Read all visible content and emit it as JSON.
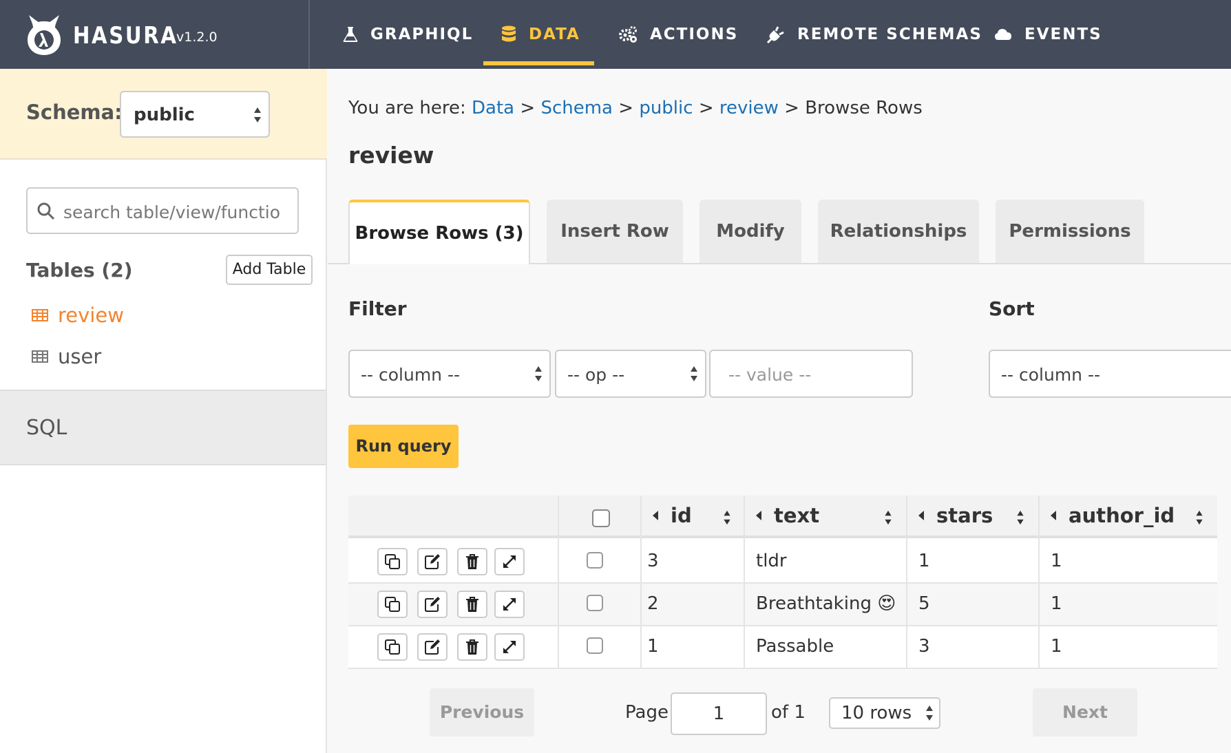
{
  "app": {
    "brand": "HASURA",
    "version": "v1.2.0"
  },
  "nav": {
    "items": [
      {
        "label": "GRAPHIQL",
        "icon": "flask-icon"
      },
      {
        "label": "DATA",
        "icon": "database-icon",
        "active": true
      },
      {
        "label": "ACTIONS",
        "icon": "cogs-icon"
      },
      {
        "label": "REMOTE SCHEMAS",
        "icon": "plug-icon"
      },
      {
        "label": "EVENTS",
        "icon": "cloud-icon"
      }
    ]
  },
  "sidebar": {
    "schema_label": "Schema:",
    "schema_value": "public",
    "search_placeholder": "search table/view/functio",
    "tables_title": "Tables (2)",
    "add_table": "Add Table",
    "tables": [
      {
        "name": "review",
        "active": true
      },
      {
        "name": "user",
        "active": false
      }
    ],
    "sql_label": "SQL"
  },
  "breadcrumb": {
    "prefix": "You are here:",
    "items": [
      "Data",
      "Schema",
      "public",
      "review"
    ],
    "current": "Browse Rows",
    "separator": ">"
  },
  "page": {
    "title": "review"
  },
  "tabs": [
    {
      "label": "Browse Rows (3)",
      "active": true
    },
    {
      "label": "Insert Row"
    },
    {
      "label": "Modify"
    },
    {
      "label": "Relationships"
    },
    {
      "label": "Permissions"
    }
  ],
  "filter": {
    "title": "Filter",
    "column_placeholder": "-- column --",
    "op_placeholder": "-- op --",
    "value_placeholder": "-- value --"
  },
  "sort": {
    "title": "Sort",
    "column_placeholder": "-- column --"
  },
  "run_query_label": "Run query",
  "table": {
    "columns": [
      "id",
      "text",
      "stars",
      "author_id"
    ],
    "rows": [
      {
        "id": "3",
        "text": "tldr",
        "stars": "1",
        "author_id": "1"
      },
      {
        "id": "2",
        "text": "Breathtaking 😍",
        "stars": "5",
        "author_id": "1"
      },
      {
        "id": "1",
        "text": "Passable",
        "stars": "3",
        "author_id": "1"
      }
    ],
    "row_actions": [
      "clone-icon",
      "edit-icon",
      "delete-icon",
      "expand-icon"
    ]
  },
  "pagination": {
    "previous": "Previous",
    "page_label": "Page",
    "page_value": "1",
    "of_label": "of 1",
    "rows_option": "10 rows",
    "next": "Next"
  }
}
